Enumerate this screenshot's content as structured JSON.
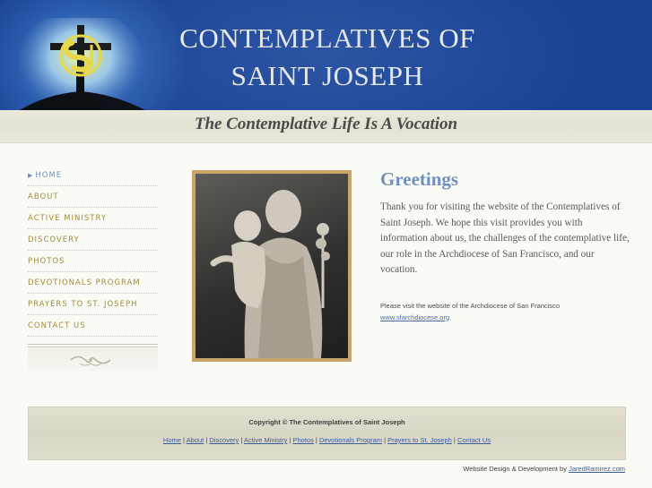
{
  "header": {
    "title_line1": "Contemplatives of",
    "title_line2": "Saint Joseph",
    "logo_icon": "csj-cross-logo-icon"
  },
  "tagline": "The Contemplative Life Is A Vocation",
  "nav": {
    "items": [
      {
        "label": "Home",
        "active": true
      },
      {
        "label": "About"
      },
      {
        "label": "Active Ministry"
      },
      {
        "label": "Discovery"
      },
      {
        "label": "Photos"
      },
      {
        "label": "Devotionals Program"
      },
      {
        "label": "Prayers to St. Joseph"
      },
      {
        "label": "Contact Us"
      }
    ]
  },
  "photo": {
    "icon": "st-joseph-statue-photo"
  },
  "main": {
    "title": "Greetings",
    "body": "Thank you for visiting the website of the Contemplatives of Saint Joseph. We hope this visit provides you with information about us, the challenges of the contemplative life, our role in the Archdiocese of San Francisco, and our vocation.",
    "visit_note": "Please visit the website of the Archdiocese of San Francisco",
    "visit_link": "www.sfarchdiocese.org"
  },
  "footer": {
    "copyright": "Copyright © The Contemplatives of Saint Joseph",
    "links": [
      "Home",
      "About",
      "Discovery",
      "Active Ministry",
      "Photos",
      "Devotionals Program",
      "Prayers to St. Joseph",
      "Contact Us"
    ],
    "separator": " | "
  },
  "credit": {
    "text": "Website Design & Development by ",
    "link": "JaredRamirez.com"
  },
  "colors": {
    "header_blue": "#1c4496",
    "nav_gold": "#a08a3e",
    "accent_blue": "#6f8fbc",
    "frame_gold": "#c9a56a"
  }
}
